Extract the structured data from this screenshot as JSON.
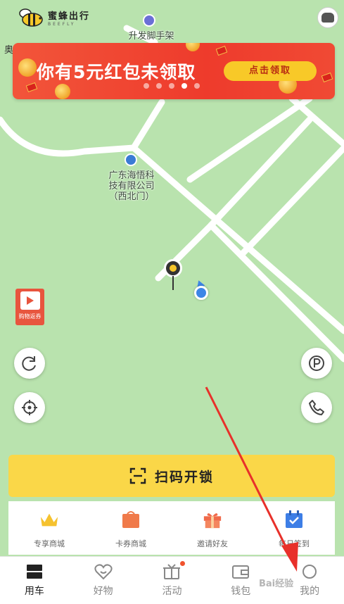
{
  "app": {
    "logo_cn": "蜜蜂出行",
    "logo_en": "BEEFLY"
  },
  "map": {
    "corner_text": "奥",
    "pois": [
      {
        "label": "升发脚手架"
      },
      {
        "label": "广东海悟科\n技有限公司\n（西北门）"
      }
    ]
  },
  "banner": {
    "title": "你有5元红包未领取",
    "button": "点击领取",
    "page_count": 5,
    "active_index": 3
  },
  "coupon_badge": {
    "label": "购物返券"
  },
  "scan": {
    "label": "扫码开锁"
  },
  "quick_entries": [
    {
      "label": "专享商城",
      "icon": "crown-icon",
      "color": "#f5c22f"
    },
    {
      "label": "卡券商城",
      "icon": "coupon-bag-icon",
      "color": "#f07a4a"
    },
    {
      "label": "邀请好友",
      "icon": "gift-icon",
      "color": "#f06a4a"
    },
    {
      "label": "每日签到",
      "icon": "calendar-check-icon",
      "color": "#3d7ee6"
    }
  ],
  "tabs": [
    {
      "label": "用车",
      "icon": "bike-card-icon",
      "active": true
    },
    {
      "label": "好物",
      "icon": "heart-icon",
      "active": false
    },
    {
      "label": "活动",
      "icon": "gift-box-icon",
      "active": false,
      "badge": true
    },
    {
      "label": "钱包",
      "icon": "wallet-icon",
      "active": false
    },
    {
      "label": "我的",
      "icon": "profile-icon",
      "active": false
    }
  ],
  "watermark": "Bai经验",
  "colors": {
    "accent_yellow": "#fad748",
    "banner_red": "#ee3b2c",
    "map_green": "#b9e3ae",
    "annotation_red": "#e8302a"
  }
}
